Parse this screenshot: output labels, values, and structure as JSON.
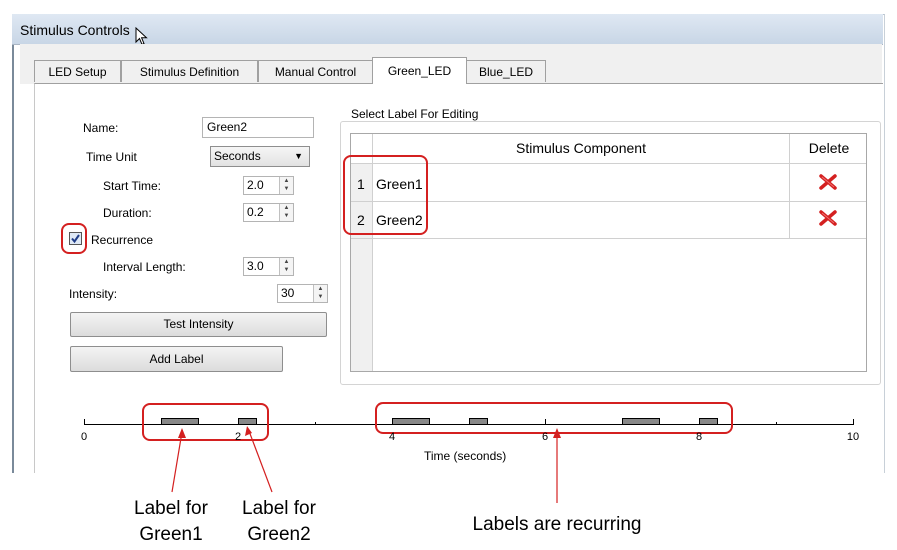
{
  "window": {
    "title": "Stimulus Controls"
  },
  "tabs": [
    {
      "label": "LED Setup",
      "active": false
    },
    {
      "label": "Stimulus Definition",
      "active": false
    },
    {
      "label": "Manual Control",
      "active": false
    },
    {
      "label": "Green_LED",
      "active": true
    },
    {
      "label": "Blue_LED",
      "active": false
    }
  ],
  "form": {
    "name_label": "Name:",
    "name_value": "Green2",
    "time_unit_label": "Time Unit",
    "time_unit_value": "Seconds",
    "start_time_label": "Start Time:",
    "start_time_value": "2.0",
    "duration_label": "Duration:",
    "duration_value": "0.2",
    "recurrence_label": "Recurrence",
    "recurrence_checked": true,
    "interval_label": "Interval Length:",
    "interval_value": "3.0",
    "intensity_label": "Intensity:",
    "intensity_value": "30",
    "test_intensity_button": "Test Intensity",
    "add_label_button": "Add Label"
  },
  "label_group": {
    "title": "Select Label For Editing",
    "col_component": "Stimulus Component",
    "col_delete": "Delete",
    "rows": [
      {
        "index": "1",
        "name": "Green1"
      },
      {
        "index": "2",
        "name": "Green2"
      }
    ]
  },
  "timeline": {
    "xlabel": "Time (seconds)",
    "tick_labels": [
      "0",
      "2",
      "4",
      "6",
      "8",
      "10"
    ],
    "xlim": [
      0,
      10
    ],
    "pulses": [
      {
        "start": 1.0,
        "end": 1.5,
        "label": "Green1"
      },
      {
        "start": 2.0,
        "end": 2.25,
        "label": "Green2"
      },
      {
        "start": 4.0,
        "end": 4.5,
        "label": "Green1"
      },
      {
        "start": 5.0,
        "end": 5.25,
        "label": "Green2"
      },
      {
        "start": 7.0,
        "end": 7.5,
        "label": "Green1"
      },
      {
        "start": 8.0,
        "end": 8.25,
        "label": "Green2"
      }
    ]
  },
  "annotations": {
    "green1": "Label for Green1",
    "green2": "Label for Green2",
    "recurring": "Labels are recurring"
  },
  "colors": {
    "highlight": "#d42020",
    "delete_icon": "#d42020",
    "pulse_fill": "#888888"
  },
  "icons": {
    "delete": "red-x-icon",
    "cursor": "mouse-pointer-icon",
    "dropdown": "chevron-down-icon"
  }
}
